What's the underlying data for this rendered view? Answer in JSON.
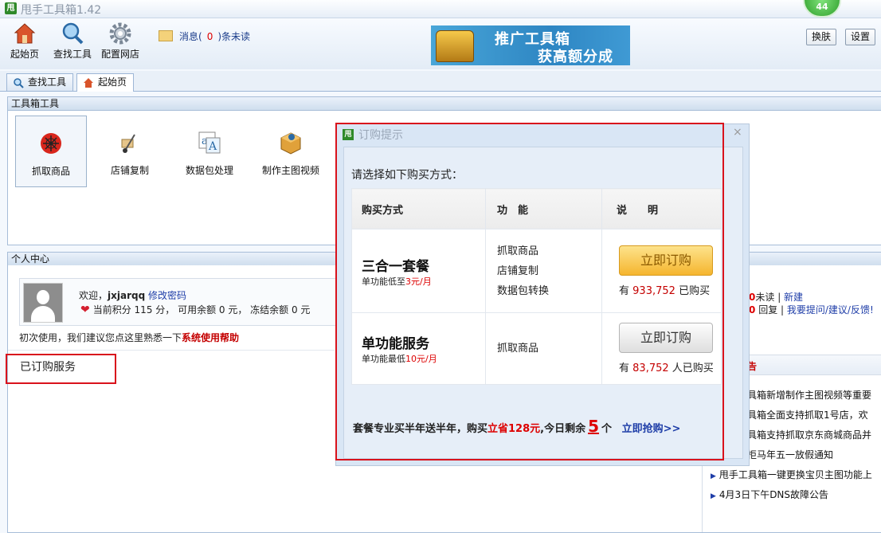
{
  "app": {
    "title": "甩手工具箱",
    "version": "1.42",
    "logo_text": "甩",
    "badge": "44"
  },
  "toolbar": {
    "home": "起始页",
    "find": "查找工具",
    "config": "配置网店",
    "msg_prefix": "消息(",
    "msg_count": "0",
    "msg_suffix": ")条未读",
    "promo_line1": "推广工具箱",
    "promo_line2": "获高额分成",
    "skin": "换肤",
    "settings": "设置"
  },
  "tabs": [
    {
      "label": "查找工具"
    },
    {
      "label": "起始页"
    }
  ],
  "tools_panel": {
    "title": "工具箱工具",
    "items": [
      "抓取商品",
      "店铺复制",
      "数据包处理",
      "制作主图视频"
    ]
  },
  "personal": {
    "title": "个人中心",
    "welcome_prefix": "欢迎，",
    "username": "jxjarqq",
    "change_pwd": "修改密码",
    "points_text": "当前积分 115 分， 可用余额 0 元， 冻结余额 0 元",
    "first_use": "初次使用，我们建议您点这里熟悉一下",
    "help_link": "系统使用帮助",
    "subscribed": "已订购服务"
  },
  "right": {
    "line1_count": "0",
    "line1_unread": "未读",
    "line1_new": "新建",
    "line2_count": "0",
    "line2_reply": "回复",
    "line2_link": "我要提问/建议/反馈!",
    "notice_title": "告",
    "notices": [
      "具箱新增制作主图视频等重要",
      "具箱全面支持抓取1号店，欢",
      "具箱支持抓取京东商城商品并",
      "柜马年五一放假通知",
      "甩手工具箱一键更换宝贝主图功能上",
      "4月3日下午DNS故障公告"
    ]
  },
  "dialog": {
    "title": "订购提示",
    "close": "×",
    "prompt": "请选择如下购买方式：",
    "headers": [
      "购买方式",
      "功　能",
      "说　　明"
    ],
    "plans": [
      {
        "name": "三合一套餐",
        "note_prefix": "单功能低至",
        "note_price": "3元/月",
        "features": [
          "抓取商品",
          "店铺复制",
          "数据包转换"
        ],
        "button": "立即订购",
        "buyers_prefix": "有",
        "buyers_count": "933,752",
        "buyers_suffix": "已购买"
      },
      {
        "name": "单功能服务",
        "note_prefix": "单功能最低",
        "note_price": "10元/月",
        "features": [
          "抓取商品"
        ],
        "button": "立即订购",
        "buyers_prefix": "有",
        "buyers_count": "83,752",
        "buyers_suffix": "人已购买"
      }
    ],
    "promo_text1": "套餐专业买半年送半年，购买",
    "promo_save": "立省128元",
    "promo_text2": ",今日剩余",
    "promo_left": "5",
    "promo_unit": "个",
    "promo_link": "立即抢购>>"
  }
}
